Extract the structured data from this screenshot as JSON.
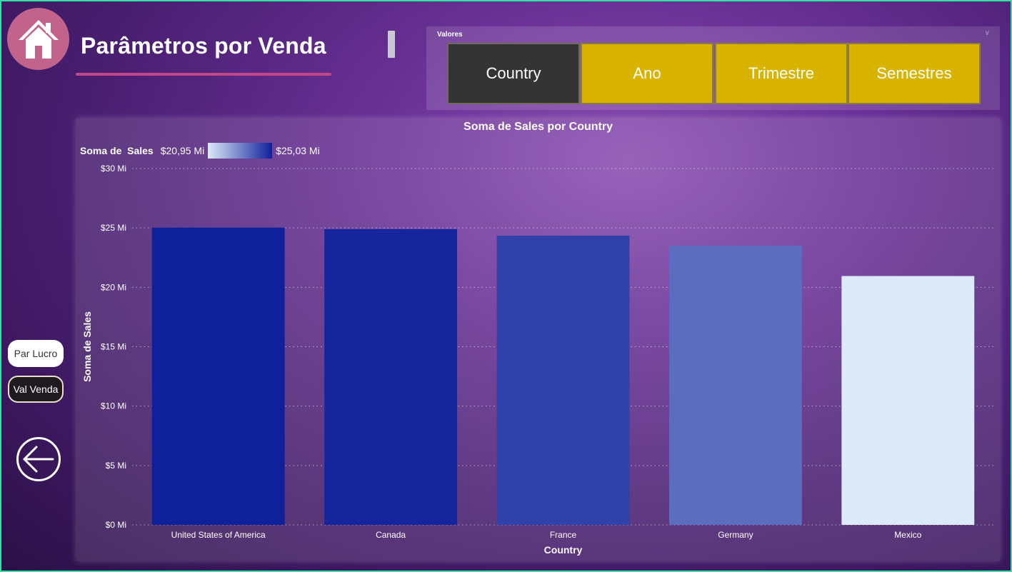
{
  "page": {
    "title": "Parâmetros por Venda"
  },
  "slicer": {
    "title": "Valores",
    "options": [
      {
        "label": "Country",
        "selected": true
      },
      {
        "label": "Ano",
        "selected": false
      },
      {
        "label": "Trimestre",
        "selected": false
      },
      {
        "label": "Semestres",
        "selected": false
      }
    ]
  },
  "side_buttons": {
    "profit": "Par Lucro",
    "sales": "Val Venda"
  },
  "legend": {
    "label": "Soma de  Sales",
    "min_label": "$20,95 Mi",
    "max_label": "$25,03 Mi"
  },
  "colors": {
    "tile_selected": "#343434",
    "tile_unselected": "#d8b300",
    "gradient_low": "#ddeaf9",
    "gradient_high": "#0e209a",
    "home": "#c1638a",
    "frame": "#35e0a2"
  },
  "icons": {
    "home": "home-icon",
    "back": "arrow-left-circle-icon"
  },
  "chart_data": {
    "type": "bar",
    "title": "Soma de Sales por Country",
    "xlabel": "Country",
    "ylabel": "Soma de Sales",
    "categories": [
      "United States of America",
      "Canada",
      "France",
      "Germany",
      "Mexico"
    ],
    "values": [
      25.03,
      24.9,
      24.35,
      23.5,
      20.95
    ],
    "unit": "Mi",
    "ylim": [
      0,
      30
    ],
    "yticks": [
      0,
      5,
      10,
      15,
      20,
      25,
      30
    ],
    "ytick_labels": [
      "$0 Mi",
      "$5 Mi",
      "$10 Mi",
      "$15 Mi",
      "$20 Mi",
      "$25 Mi",
      "$30 Mi"
    ],
    "grid": true,
    "color_scale": {
      "min": 20.95,
      "max": 25.03,
      "low_color": "#ddeaf9",
      "high_color": "#0e209a"
    }
  }
}
